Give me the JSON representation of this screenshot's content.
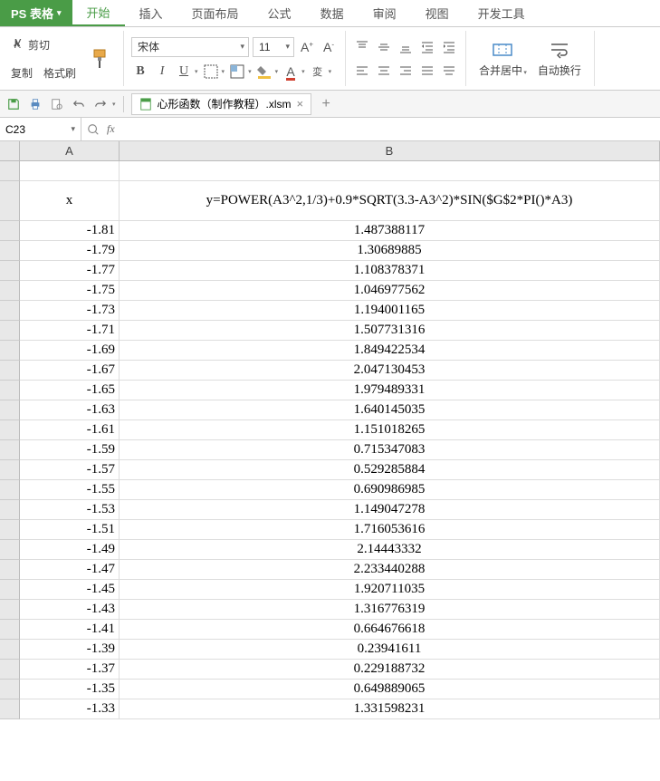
{
  "app": {
    "name": "PS 表格"
  },
  "tabs": [
    "开始",
    "插入",
    "页面布局",
    "公式",
    "数据",
    "审阅",
    "视图",
    "开发工具"
  ],
  "active_tab": 0,
  "ribbon": {
    "cut": "剪切",
    "copy": "复制",
    "format_painter": "格式刷",
    "font_name": "宋体",
    "font_size": "11",
    "merge_center": "合并居中",
    "wrap_text": "自动换行"
  },
  "document": {
    "name": "心形函数（制作教程）.xlsm"
  },
  "name_box": "C23",
  "fx_label": "fx",
  "columns": [
    "A",
    "B"
  ],
  "header_row": {
    "a": "x",
    "b": "y=POWER(A3^2,1/3)+0.9*SQRT(3.3-A3^2)*SIN($G$2*PI()*A3)"
  },
  "chart_data": {
    "type": "table",
    "columns": [
      "x",
      "y"
    ],
    "rows": [
      [
        -1.81,
        1.487388117
      ],
      [
        -1.79,
        1.30689885
      ],
      [
        -1.77,
        1.108378371
      ],
      [
        -1.75,
        1.046977562
      ],
      [
        -1.73,
        1.194001165
      ],
      [
        -1.71,
        1.507731316
      ],
      [
        -1.69,
        1.849422534
      ],
      [
        -1.67,
        2.047130453
      ],
      [
        -1.65,
        1.979489331
      ],
      [
        -1.63,
        1.640145035
      ],
      [
        -1.61,
        1.151018265
      ],
      [
        -1.59,
        0.715347083
      ],
      [
        -1.57,
        0.529285884
      ],
      [
        -1.55,
        0.690986985
      ],
      [
        -1.53,
        1.149047278
      ],
      [
        -1.51,
        1.716053616
      ],
      [
        -1.49,
        2.14443332
      ],
      [
        -1.47,
        2.233440288
      ],
      [
        -1.45,
        1.920711035
      ],
      [
        -1.43,
        1.316776319
      ],
      [
        -1.41,
        0.664676618
      ],
      [
        -1.39,
        0.23941611
      ],
      [
        -1.37,
        0.229188732
      ],
      [
        -1.35,
        0.649889065
      ],
      [
        -1.33,
        1.331598231
      ]
    ]
  }
}
